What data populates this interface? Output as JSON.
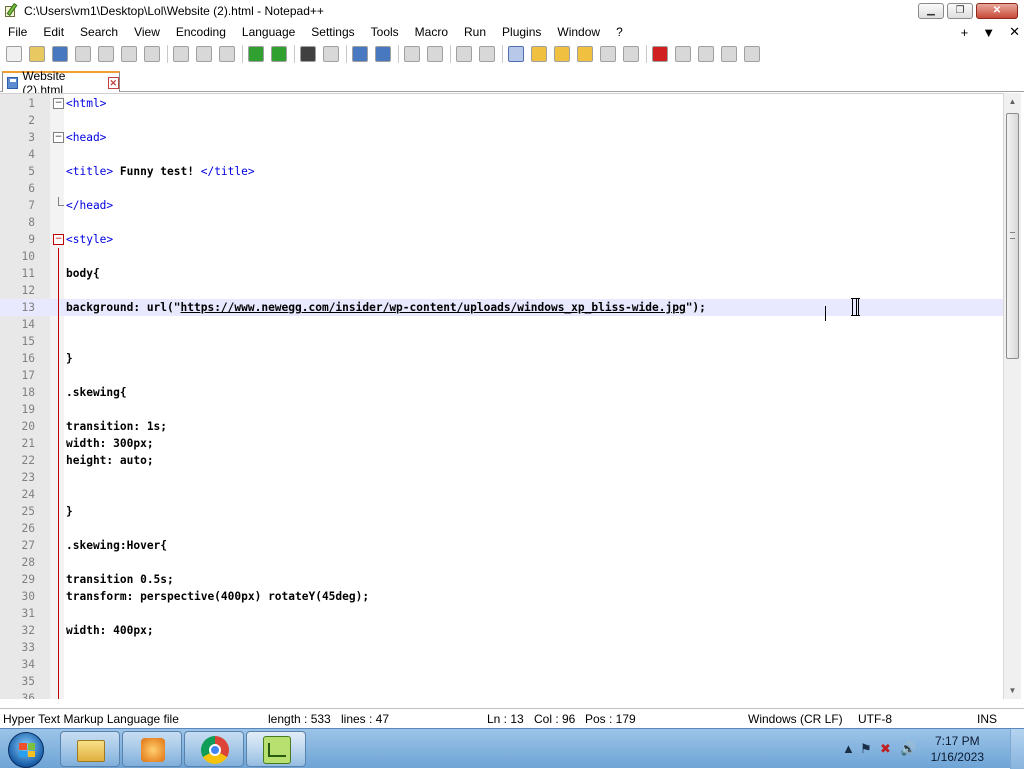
{
  "window": {
    "title": "C:\\Users\\vm1\\Desktop\\Lol\\Website (2).html - Notepad++",
    "minimize_glyph": "▁",
    "maximize_glyph": "❐",
    "close_glyph": "✕"
  },
  "menu": {
    "items": [
      "File",
      "Edit",
      "Search",
      "View",
      "Encoding",
      "Language",
      "Settings",
      "Tools",
      "Macro",
      "Run",
      "Plugins",
      "Window",
      "?"
    ],
    "right": [
      "+",
      "▼",
      "✕"
    ]
  },
  "tab": {
    "label": "Website (2).html",
    "close_glyph": "✕"
  },
  "editor": {
    "lines": [
      {
        "n": "1",
        "text": "<html>",
        "fold": "minus"
      },
      {
        "n": "2",
        "text": ""
      },
      {
        "n": "3",
        "text": "<head>",
        "fold": "minus"
      },
      {
        "n": "4",
        "text": ""
      },
      {
        "n": "5",
        "text": "<title> Funny test! </title>"
      },
      {
        "n": "6",
        "text": ""
      },
      {
        "n": "7",
        "text": "</head>"
      },
      {
        "n": "8",
        "text": ""
      },
      {
        "n": "9",
        "text": "<style>",
        "fold": "minus-red"
      },
      {
        "n": "10",
        "text": ""
      },
      {
        "n": "11",
        "text": "body{"
      },
      {
        "n": "12",
        "text": ""
      },
      {
        "n": "13",
        "text": "background: url(\"https://www.newegg.com/insider/wp-content/uploads/windows_xp_bliss-wide.jpg\");",
        "current": true
      },
      {
        "n": "14",
        "text": ""
      },
      {
        "n": "15",
        "text": ""
      },
      {
        "n": "16",
        "text": "}"
      },
      {
        "n": "17",
        "text": ""
      },
      {
        "n": "18",
        "text": ".skewing{"
      },
      {
        "n": "19",
        "text": ""
      },
      {
        "n": "20",
        "text": "transition: 1s;"
      },
      {
        "n": "21",
        "text": "width: 300px;"
      },
      {
        "n": "22",
        "text": "height: auto;"
      },
      {
        "n": "23",
        "text": ""
      },
      {
        "n": "24",
        "text": ""
      },
      {
        "n": "25",
        "text": "}"
      },
      {
        "n": "26",
        "text": ""
      },
      {
        "n": "27",
        "text": ".skewing:Hover{"
      },
      {
        "n": "28",
        "text": ""
      },
      {
        "n": "29",
        "text": "transition 0.5s;"
      },
      {
        "n": "30",
        "text": "transform: perspective(400px) rotateY(45deg);"
      },
      {
        "n": "31",
        "text": ""
      },
      {
        "n": "32",
        "text": "width: 400px;"
      },
      {
        "n": "33",
        "text": ""
      },
      {
        "n": "34",
        "text": ""
      },
      {
        "n": "35",
        "text": ""
      },
      {
        "n": "36",
        "text": ""
      }
    ]
  },
  "status": {
    "file_type": "Hyper Text Markup Language file",
    "length": "length : 533",
    "lines": "lines : 47",
    "ln": "Ln : 13",
    "col": "Col : 96",
    "pos": "Pos : 179",
    "eol": "Windows (CR LF)",
    "encoding": "UTF-8",
    "mode": "INS"
  },
  "taskbar": {
    "apps": [
      "explorer-icon",
      "media-player-icon",
      "chrome-icon",
      "notepadpp-icon"
    ],
    "time": "7:17 PM",
    "date": "1/16/2023"
  },
  "colors": {
    "tag": "#0000e0",
    "current_line": "#e8e8ff",
    "tab_accent": "#f0a030",
    "taskbar": "#7eaede"
  }
}
